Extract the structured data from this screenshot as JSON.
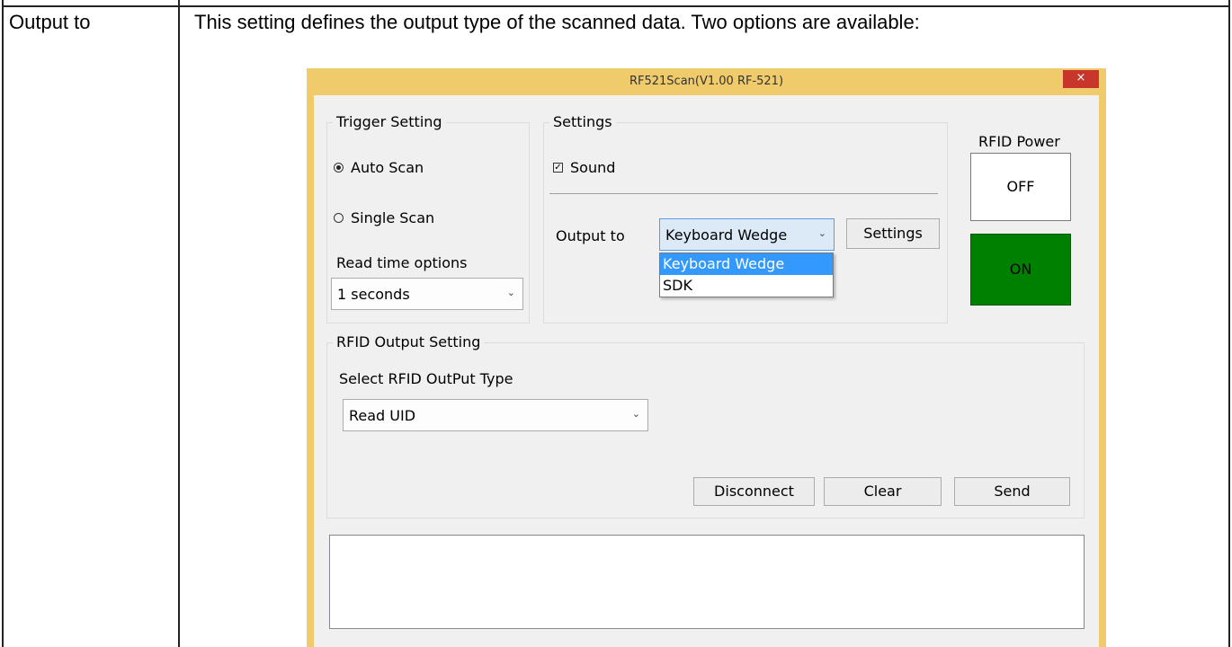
{
  "document": {
    "row_label": "Output to",
    "row_description": "This setting defines the output type of the scanned data. Two options are available:"
  },
  "window": {
    "title": "RF521Scan(V1.00 RF-521)",
    "close_glyph": "×",
    "trigger": {
      "legend": "Trigger Setting",
      "options": [
        {
          "label": "Auto Scan",
          "checked": true
        },
        {
          "label": "Single Scan",
          "checked": false
        }
      ],
      "read_time_label": "Read time options",
      "read_time_value": "1 seconds"
    },
    "settings": {
      "legend": "Settings",
      "sound_label": "Sound",
      "sound_checked": true,
      "output_label": "Output to",
      "output_value": "Keyboard Wedge",
      "output_options": [
        "Keyboard Wedge",
        "SDK"
      ],
      "output_selected": "Keyboard Wedge",
      "settings_button": "Settings"
    },
    "power": {
      "label": "RFID Power",
      "off_label": "OFF",
      "on_label": "ON",
      "on_color": "#008000"
    },
    "rfid_output": {
      "legend": "RFID Output Setting",
      "type_label": "Select RFID OutPut Type",
      "type_value": "Read UID"
    },
    "buttons": {
      "disconnect": "Disconnect",
      "clear": "Clear",
      "send": "Send"
    },
    "output_text": ""
  },
  "icons": {
    "dropdown_arrow": "⌄"
  },
  "colors": {
    "window_frame": "#f0cb6c",
    "close_button": "#c7352b",
    "selection": "#3399ff"
  }
}
